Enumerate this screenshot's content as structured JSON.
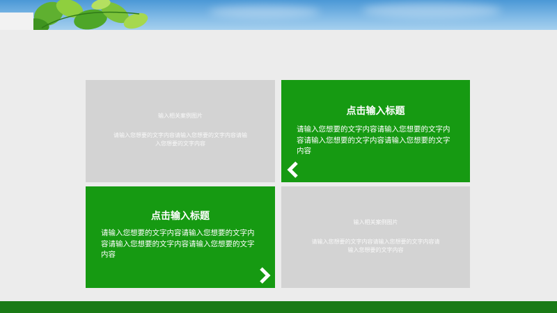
{
  "colors": {
    "accent_green": "#169a12",
    "tile_gray": "#d3d3d3",
    "footer_green": "#1a7a16",
    "background": "#ececec"
  },
  "tiles": [
    {
      "style": "gray",
      "title": "输入相关案例图片",
      "text": "请输入您想要的文字内容请输入您想要的文字内容请输入您想要的文字内容"
    },
    {
      "style": "green",
      "title": "点击输入标题",
      "text": "请输入您想要的文字内容请输入您想要的文字内容请输入您想要的文字内容请输入您想要的文字内容",
      "nav_icon": "chevron-left-icon"
    },
    {
      "style": "green",
      "title": "点击输入标题",
      "text": "请输入您想要的文字内容请输入您想要的文字内容请输入您想要的文字内容请输入您想要的文字内容",
      "nav_icon": "chevron-right-icon"
    },
    {
      "style": "gray",
      "title": "输入相关案例图片",
      "text": "请输入您想要的文字内容请输入您想要的文字内容请输入您想要的文字内容"
    }
  ]
}
